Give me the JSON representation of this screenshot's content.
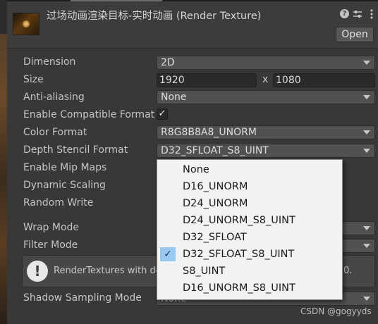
{
  "header": {
    "title": "过场动画渲染目标-实时动画 (Render Texture)",
    "open_label": "Open"
  },
  "fields": {
    "dimension": {
      "label": "Dimension",
      "value": "2D"
    },
    "size": {
      "label": "Size",
      "width": "1920",
      "separator": "x",
      "height": "1080"
    },
    "anti_aliasing": {
      "label": "Anti-aliasing",
      "value": "None"
    },
    "enable_compatible_format": {
      "label": "Enable Compatible Format",
      "checked": true
    },
    "color_format": {
      "label": "Color Format",
      "value": "R8G8B8A8_UNORM"
    },
    "depth_stencil_format": {
      "label": "Depth Stencil Format",
      "value": "D32_SFLOAT_S8_UINT"
    },
    "enable_mip_maps": {
      "label": "Enable Mip Maps"
    },
    "dynamic_scaling": {
      "label": "Dynamic Scaling"
    },
    "random_write": {
      "label": "Random Write"
    },
    "wrap_mode": {
      "label": "Wrap Mode"
    },
    "filter_mode": {
      "label": "Filter Mode"
    },
    "shadow_sampling_mode": {
      "label": "Shadow Sampling Mode",
      "value": "None"
    }
  },
  "help_box": {
    "text": "RenderTextures with de",
    "text_end": "0."
  },
  "depth_dropdown_options": [
    {
      "label": "None",
      "selected": false
    },
    {
      "label": "D16_UNORM",
      "selected": false
    },
    {
      "label": "D24_UNORM",
      "selected": false
    },
    {
      "label": "D24_UNORM_S8_UINT",
      "selected": false
    },
    {
      "label": "D32_SFLOAT",
      "selected": false
    },
    {
      "label": "D32_SFLOAT_S8_UINT",
      "selected": true
    },
    {
      "label": "S8_UINT",
      "selected": false
    },
    {
      "label": "D16_UNORM_S8_UINT",
      "selected": false
    }
  ],
  "watermark": "CSDN @gogyyds",
  "icons": {
    "help": "question-circle-icon",
    "presets": "sliders-icon",
    "more": "more-vertical-icon",
    "warning": "exclamation-icon",
    "check": "checkmark-icon"
  }
}
